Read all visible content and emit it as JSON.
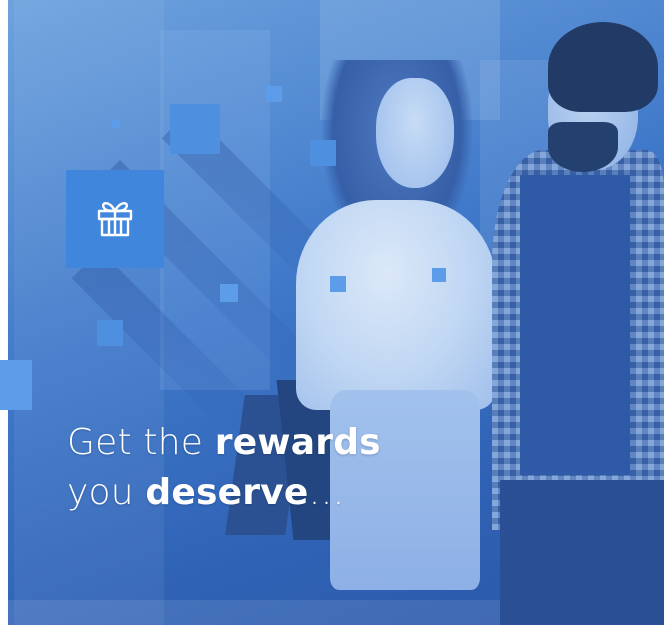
{
  "headline": {
    "line1_regular": "Get the ",
    "line1_bold": "rewards",
    "line2_regular": "you ",
    "line2_bold": "deserve",
    "line2_suffix": "…"
  },
  "icons": {
    "gift": "gift-icon"
  },
  "colors": {
    "brand_blue": "#3f78c9",
    "accent_square": "#4e8fe0",
    "text": "#ffffff"
  }
}
